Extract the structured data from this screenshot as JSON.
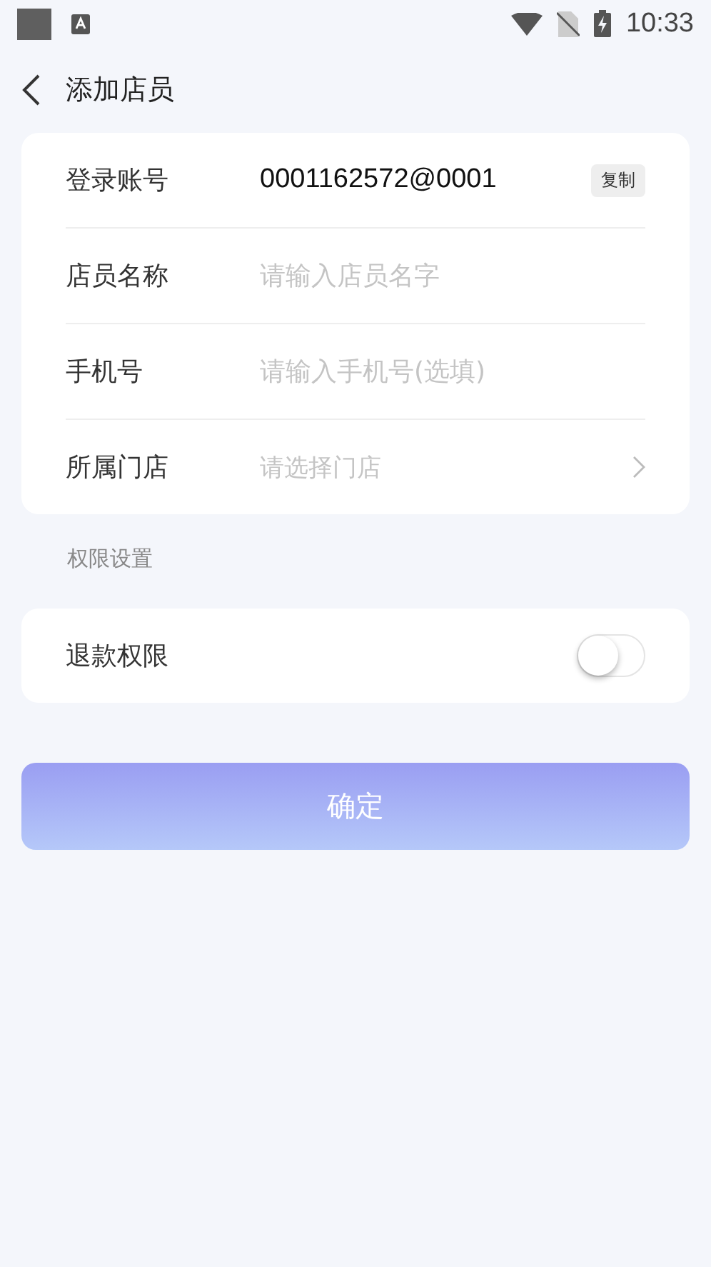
{
  "status_bar": {
    "time": "10:33"
  },
  "header": {
    "title": "添加店员"
  },
  "form": {
    "rows": [
      {
        "kind": "value",
        "label": "登录账号",
        "value": "0001162572@0001",
        "action": "复制"
      },
      {
        "kind": "input",
        "label": "店员名称",
        "placeholder": "请输入店员名字"
      },
      {
        "kind": "input",
        "label": "手机号",
        "placeholder": "请输入手机号(选填)"
      },
      {
        "kind": "select",
        "label": "所属门店",
        "placeholder": "请选择门店"
      }
    ]
  },
  "permissions": {
    "title": "权限设置",
    "items": [
      {
        "label": "退款权限",
        "on": false
      }
    ]
  },
  "confirm_button": "确定"
}
